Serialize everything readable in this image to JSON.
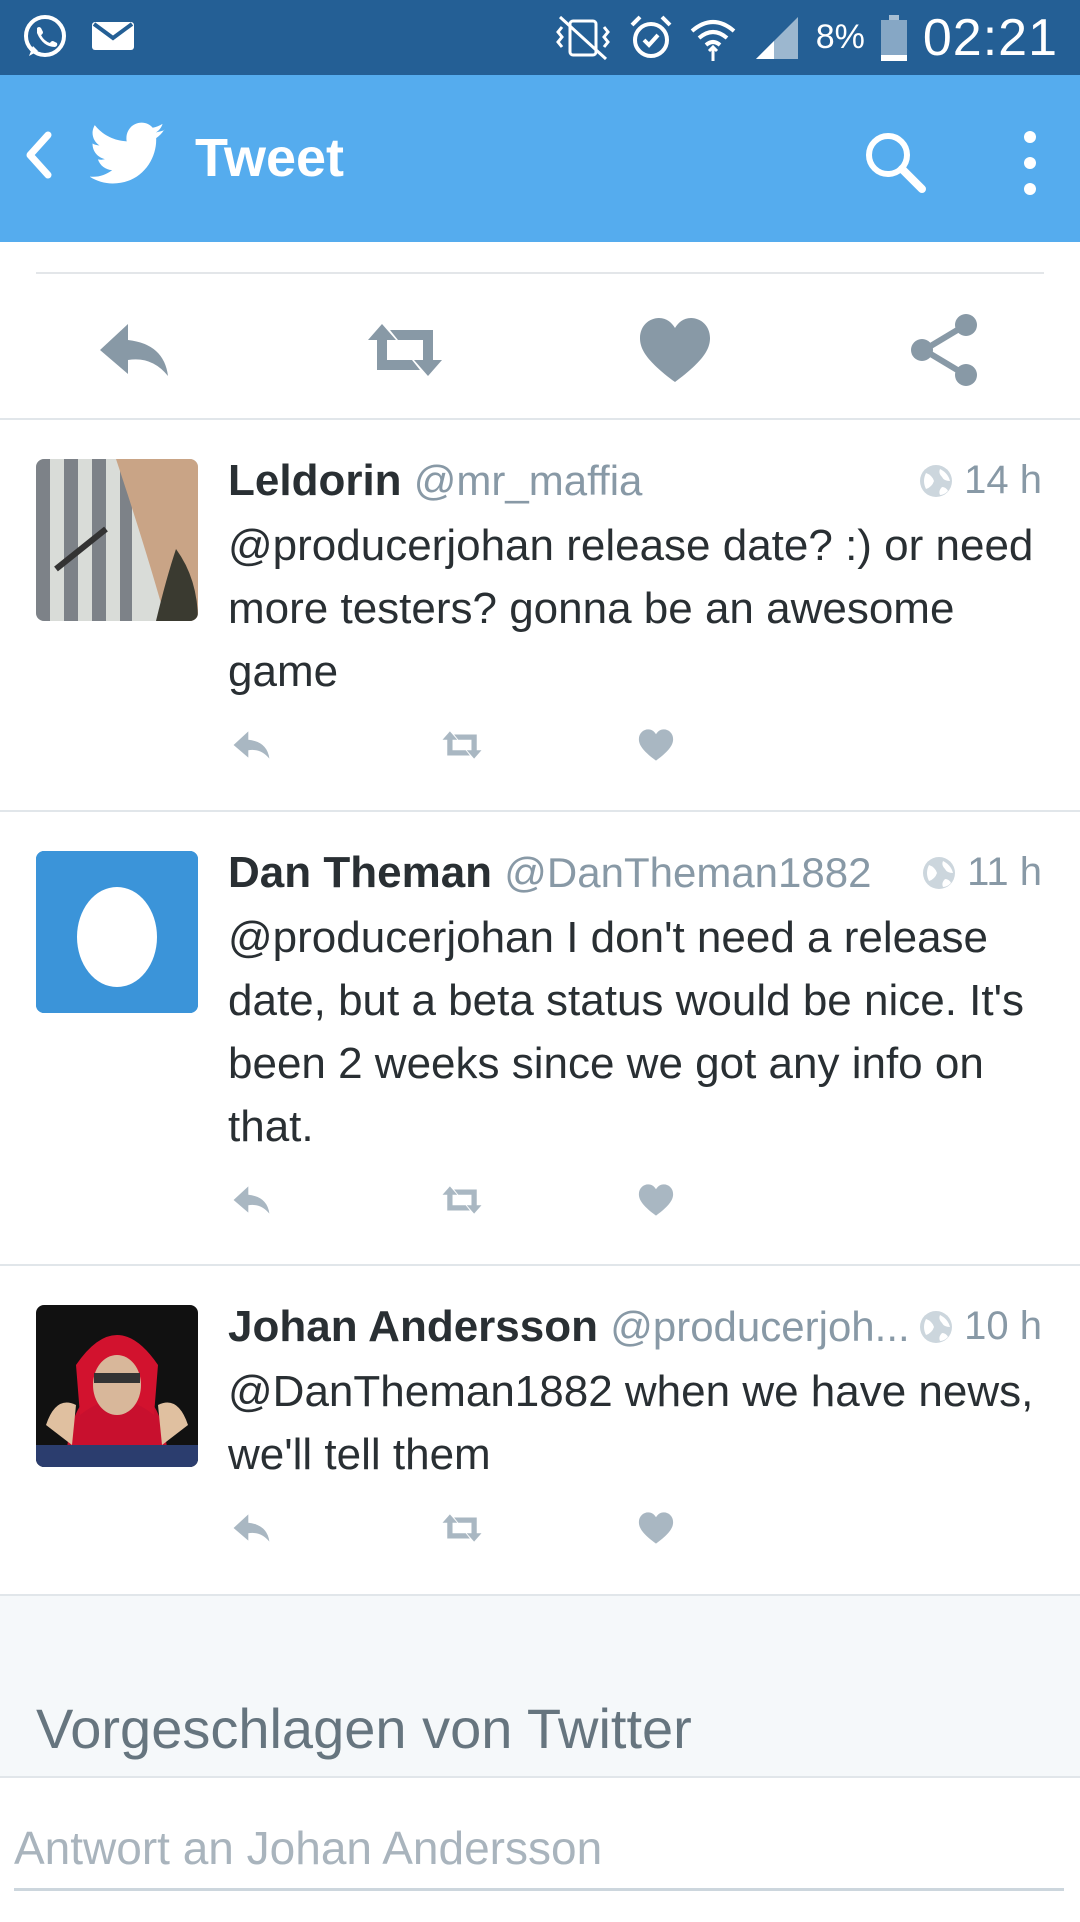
{
  "status_bar": {
    "battery": "8%",
    "time": "02:21",
    "icons": [
      "whatsapp-icon",
      "mail-icon",
      "vibrate-icon",
      "alarm-icon",
      "wifi-icon",
      "signal-icon",
      "battery-icon"
    ]
  },
  "app_bar": {
    "title": "Tweet",
    "icons": [
      "back-icon",
      "twitter-bird-icon",
      "search-icon",
      "more-vert-icon"
    ],
    "color": "#55acee"
  },
  "tweet_actions": [
    "reply-icon",
    "retweet-icon",
    "like-icon",
    "share-icon"
  ],
  "replies": [
    {
      "name": "Leldorin",
      "handle": "@mr_maffia",
      "time": "14 h",
      "text": "@producerjohan release date? :) or need more testers? gonna be an awesome game"
    },
    {
      "name": "Dan Theman",
      "handle": "@DanTheman1882",
      "time": "11 h",
      "text": "@producerjohan I don't need a release date, but a beta status would be nice. It's been 2 weeks since we got any info on that."
    },
    {
      "name": "Johan Andersson",
      "handle": "@producerjoh...",
      "time": "10 h",
      "text": "@DanTheman1882 when we have news, we'll tell them"
    }
  ],
  "suggested": {
    "heading": "Vorgeschlagen von Twitter"
  },
  "reply_box": {
    "placeholder": "Antwort an Johan Andersson"
  },
  "colors": {
    "status_bar": "#245f95",
    "accent": "#55acee",
    "icon_gray": "#8899a6",
    "egg_avatar": "#3b94d9"
  }
}
